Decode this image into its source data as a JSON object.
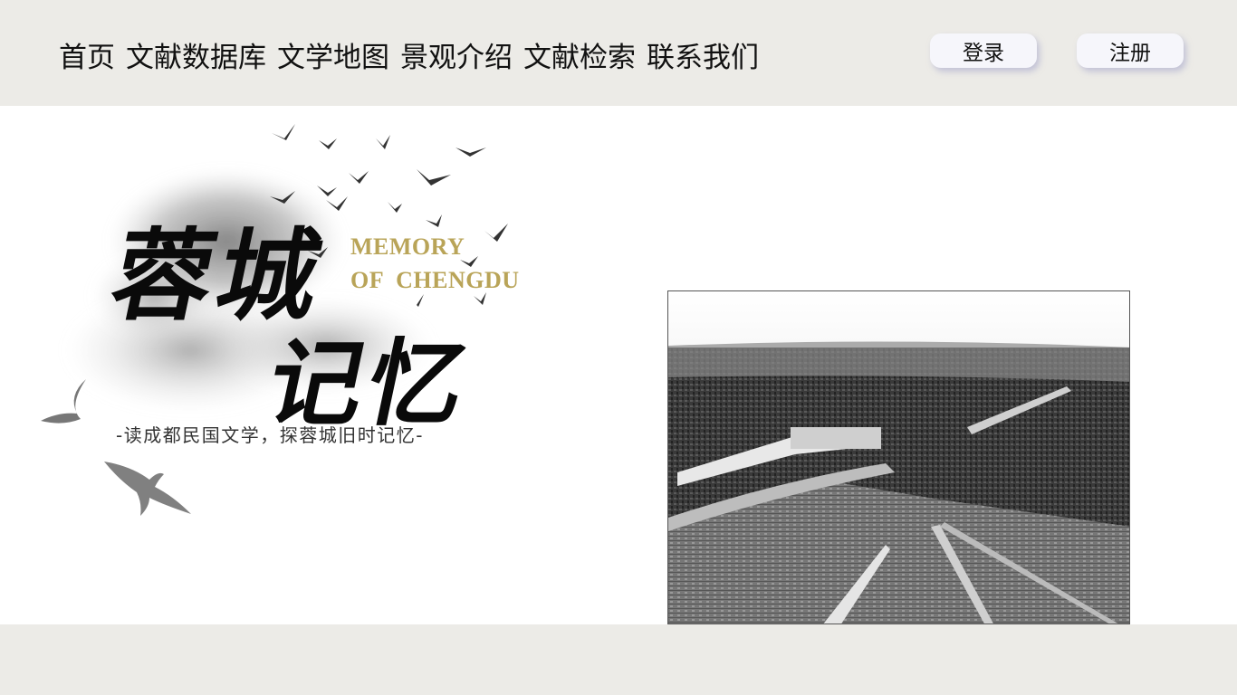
{
  "nav": {
    "items": [
      {
        "label": "首页"
      },
      {
        "label": "文献数据库"
      },
      {
        "label": "文学地图"
      },
      {
        "label": "景观介绍"
      },
      {
        "label": "文献检索"
      },
      {
        "label": "联系我们"
      }
    ]
  },
  "auth": {
    "login_label": "登录",
    "register_label": "注册"
  },
  "hero": {
    "calligraphy_line1": "蓉城",
    "calligraphy_line2": "记忆",
    "english_line1": "MEMORY",
    "english_line2": "OF  CHENGDU",
    "slogan": "-读成都民国文学，探蓉城旧时记忆-"
  },
  "colors": {
    "bar_background": "#ecebe7",
    "accent_gold": "#b9a458",
    "ink": "#0a0a0a"
  },
  "icons": {
    "birds": "flying-birds-icon",
    "swallows": "swallow-icon"
  }
}
